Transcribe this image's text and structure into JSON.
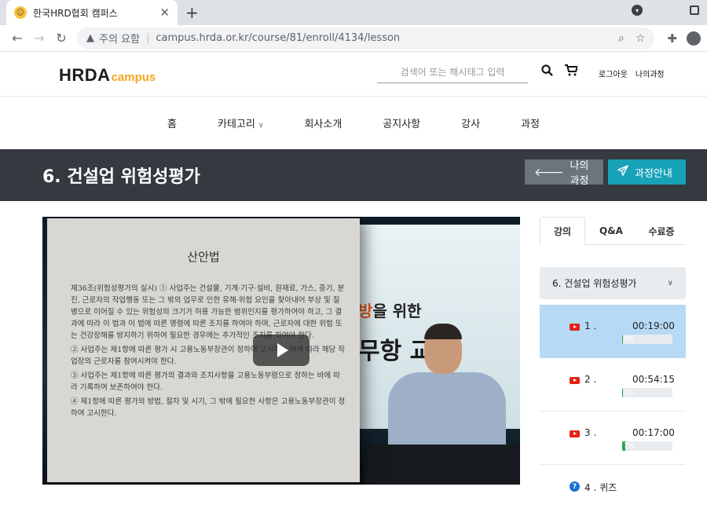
{
  "browser": {
    "tab_title": "한국HRD협회 캠퍼스",
    "security_label": "주의 요함",
    "url": "campus.hrda.or.kr/course/81/enroll/4134/lesson"
  },
  "header": {
    "logo_text": "HRDA",
    "logo_sub": "campus",
    "search_placeholder": "검색어 또는 해시태그 입력",
    "logout": "로그아웃",
    "my_courses": "나의과정"
  },
  "nav": {
    "items": [
      "홈",
      "카테고리",
      "회사소개",
      "공지사항",
      "강사",
      "과정"
    ]
  },
  "title_bar": {
    "title": "6. 건설업 위험성평가",
    "btn_my_courses": "나의과정",
    "btn_course_info": "과정안내"
  },
  "video": {
    "slide_title": "산안법",
    "slide_paragraphs": [
      "제36조(위험성평가의 실시) ① 사업주는 건설물, 기계·기구·설비, 원재료, 가스, 증기, 분진, 근로자의 작업행동 또는 그 밖의 업무로 인한 유해·위험 요인을 찾아내어 부상 및 질병으로 이어질 수 있는 위험성의 크기가 허용 가능한 범위인지를 평가하여야 하고, 그 결과에 따라 이 법과 이 법에 따른 명령에 따른 조치를 하여야 하며, 근로자에 대한 위험 또는 건강장해를 방지하기 위하여 필요한 경우에는 추가적인 조치를 하여야 한다.",
      "② 사업주는 제1항에 따른 평가 시 고용노동부장관이 정하여 고시하는 바에 따라 해당 작업장의 근로자를 참여시켜야 한다.",
      "③ 사업주는 제1항에 따른 평가의 결과와 조치사항을 고용노동부령으로 정하는 바에 따라 기록하여 보존하여야 한다.",
      "④ 제1항에 따른 평가의 방법, 절차 및 시기, 그 밖에 필요한 사항은 고용노동부장관이 정하여 고시한다."
    ],
    "bg_text1_orange": "방",
    "bg_text1_rest": "을 위한",
    "bg_text2": "무항 교육"
  },
  "side": {
    "tabs": [
      "강의",
      "Q&A",
      "수료증"
    ],
    "section_title": "6. 건설업 위험성평가",
    "lessons": [
      {
        "num": "1 .",
        "time": "00:19:00",
        "progress_label": "2%",
        "progress": 0.02
      },
      {
        "num": "2 .",
        "time": "00:54:15",
        "progress_label": "1%",
        "progress": 0.01
      },
      {
        "num": "3 .",
        "time": "00:17:00",
        "progress_label": "7%",
        "progress": 0.07
      }
    ],
    "quiz_label": "4 . 퀴즈"
  },
  "colors": {
    "title_bar_bg": "#343a40",
    "btn_secondary": "#6c757d",
    "btn_info": "#17a2b8",
    "active_lesson": "#b6daf6",
    "logo_accent": "#f2a81d"
  }
}
